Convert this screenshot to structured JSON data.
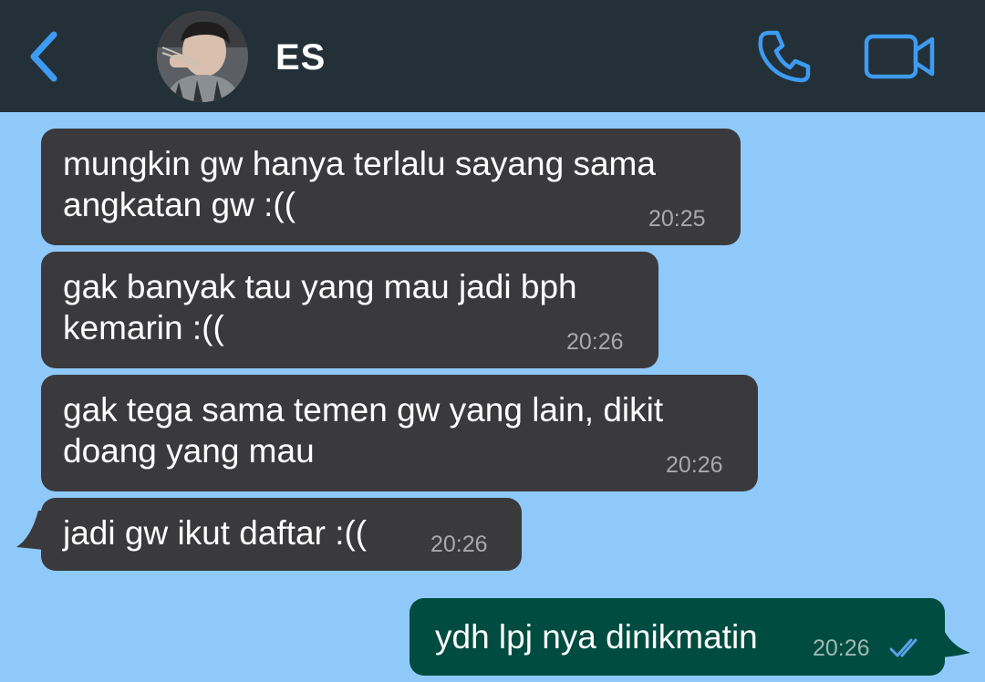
{
  "header": {
    "contact_name": "ES",
    "back_icon": "chevron-left-icon",
    "call_icon": "phone-icon",
    "video_icon": "video-camera-icon",
    "accent_color": "#3d9bf2",
    "background_color": "#243038"
  },
  "chat": {
    "background_color": "#8fc9fa",
    "messages": [
      {
        "direction": "incoming",
        "text": "mungkin gw hanya terlalu sayang sama\nangkatan gw :((",
        "time": "20:25"
      },
      {
        "direction": "incoming",
        "text": "gak banyak tau yang mau jadi bph\nkemarin :((",
        "time": "20:26"
      },
      {
        "direction": "incoming",
        "text": "gak tega sama temen gw yang lain, dikit\ndoang yang mau",
        "time": "20:26"
      },
      {
        "direction": "incoming",
        "text": "jadi gw ikut daftar :((",
        "time": "20:26"
      },
      {
        "direction": "outgoing",
        "text": "ydh lpj nya dinikmatin",
        "time": "20:26",
        "status": "read"
      }
    ]
  }
}
